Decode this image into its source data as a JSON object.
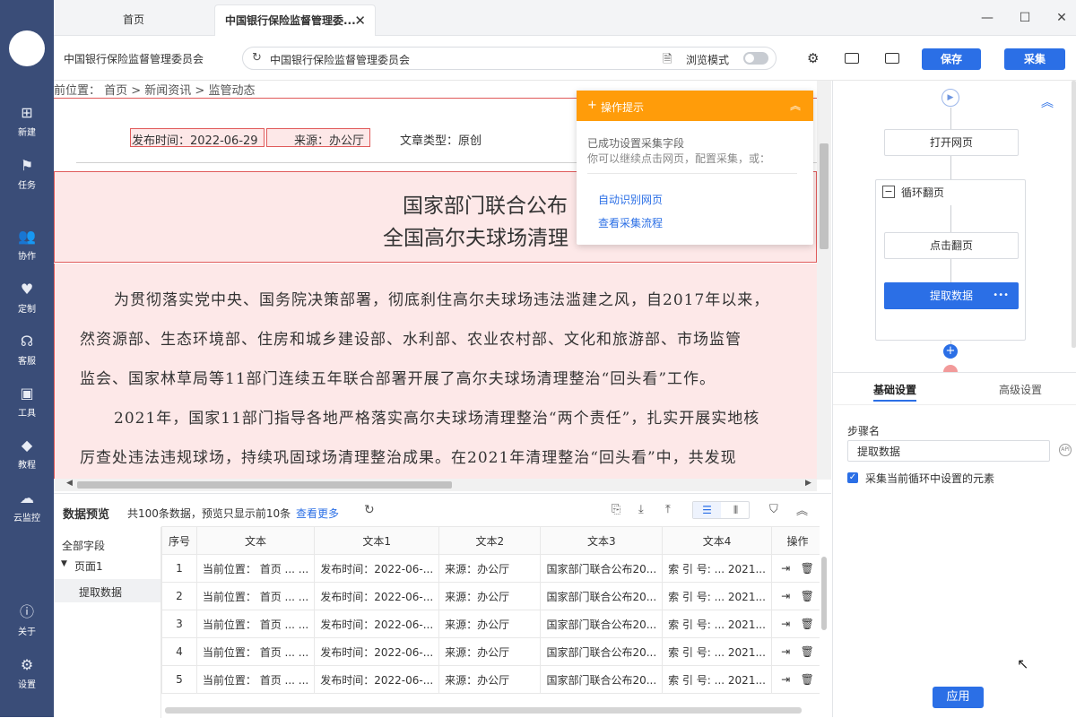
{
  "sidebar": {
    "items": [
      {
        "label": "新建",
        "icon": "plus-square-icon"
      },
      {
        "label": "任务",
        "icon": "flag-icon"
      },
      {
        "label": "协作",
        "icon": "users-icon"
      },
      {
        "label": "定制",
        "icon": "heart-check-icon"
      },
      {
        "label": "客服",
        "icon": "headset-icon"
      },
      {
        "label": "工具",
        "icon": "toolbox-icon"
      },
      {
        "label": "教程",
        "icon": "graduation-cap-icon"
      },
      {
        "label": "云监控",
        "icon": "cloud-monitor-icon"
      }
    ],
    "bottom": [
      {
        "label": "关于",
        "icon": "info-icon"
      },
      {
        "label": "设置",
        "icon": "gear-icon"
      }
    ]
  },
  "tabs": {
    "home": "首页",
    "active": "中国银行保险监督管理委..."
  },
  "toolbar": {
    "site_title": "中国银行保险监督管理委员会",
    "url": "中国银行保险监督管理委员会",
    "browse_mode": "浏览模式",
    "save": "保存",
    "collect": "采集"
  },
  "page": {
    "breadcrumb": "前位置： 首页 > 新闻资讯 > 监管动态",
    "publish_time": "发布时间：2022-06-29",
    "source": "来源：办公厅",
    "article_type": "文章类型：原创",
    "title_line1": "国家部门联合公布",
    "title_line2": "全国高尔夫球场清理",
    "paragraphs": [
      "为贯彻落实党中央、国务院决策部署，彻底刹住高尔夫球场违法滥建之风，自2017年以来，",
      "然资源部、生态环境部、住房和城乡建设部、水利部、农业农村部、文化和旅游部、市场监管",
      "监会、国家林草局等11部门连续五年联合部署开展了高尔夫球场清理整治“回头看”工作。",
      "2021年，国家11部门指导各地严格落实高尔夫球场清理整治“两个责任”，扎实开展实地核",
      "厉查处违法违规球场，持续巩固球场清理整治成果。在2021年清理整治“回头看”中，共发现"
    ]
  },
  "tip": {
    "header": "操作提示",
    "line1": "已成功设置采集字段",
    "line2": "你可以继续点击网页，配置采集，或：",
    "link1": "自动识别网页",
    "link2": "查看采集流程"
  },
  "preview": {
    "title": "数据预览",
    "summary": "共100条数据，预览只显示前10条",
    "more": "查看更多",
    "all_fields": "全部字段",
    "tree_page": "页面1",
    "tree_item": "提取数据",
    "columns": [
      "序号",
      "文本",
      "文本1",
      "文本2",
      "文本3",
      "文本4",
      "操作"
    ],
    "rows": [
      [
        "1",
        "当前位置： 首页 ... ...",
        "发布时间：2022-06-...",
        "来源：办公厅",
        "国家部门联合公布20...",
        "索 引 号: ... 2021..."
      ],
      [
        "2",
        "当前位置： 首页 ... ...",
        "发布时间：2022-06-...",
        "来源：办公厅",
        "国家部门联合公布20...",
        "索 引 号: ... 2021..."
      ],
      [
        "3",
        "当前位置： 首页 ... ...",
        "发布时间：2022-06-...",
        "来源：办公厅",
        "国家部门联合公布20...",
        "索 引 号: ... 2021..."
      ],
      [
        "4",
        "当前位置： 首页 ... ...",
        "发布时间：2022-06-...",
        "来源：办公厅",
        "国家部门联合公布20...",
        "索 引 号: ... 2021..."
      ],
      [
        "5",
        "当前位置： 首页 ... ...",
        "发布时间：2022-06-...",
        "来源：办公厅",
        "国家部门联合公布20...",
        "索 引 号: ... 2021..."
      ]
    ]
  },
  "flow": {
    "open_page": "打开网页",
    "loop": "循环翻页",
    "click_page": "点击翻页",
    "extract": "提取数据",
    "more": "•••"
  },
  "settings": {
    "tab_basic": "基础设置",
    "tab_advanced": "高级设置",
    "step_name_label": "步骤名",
    "step_name_value": "提取数据",
    "checkbox_label": "采集当前循环中设置的元素",
    "apply": "应用"
  },
  "colors": {
    "sidebar": "#3a4d78",
    "accent": "#2b6fe6",
    "tip": "#ff9c0a",
    "highlight_border": "#e05a5a",
    "highlight_fill": "#fde8e8"
  }
}
